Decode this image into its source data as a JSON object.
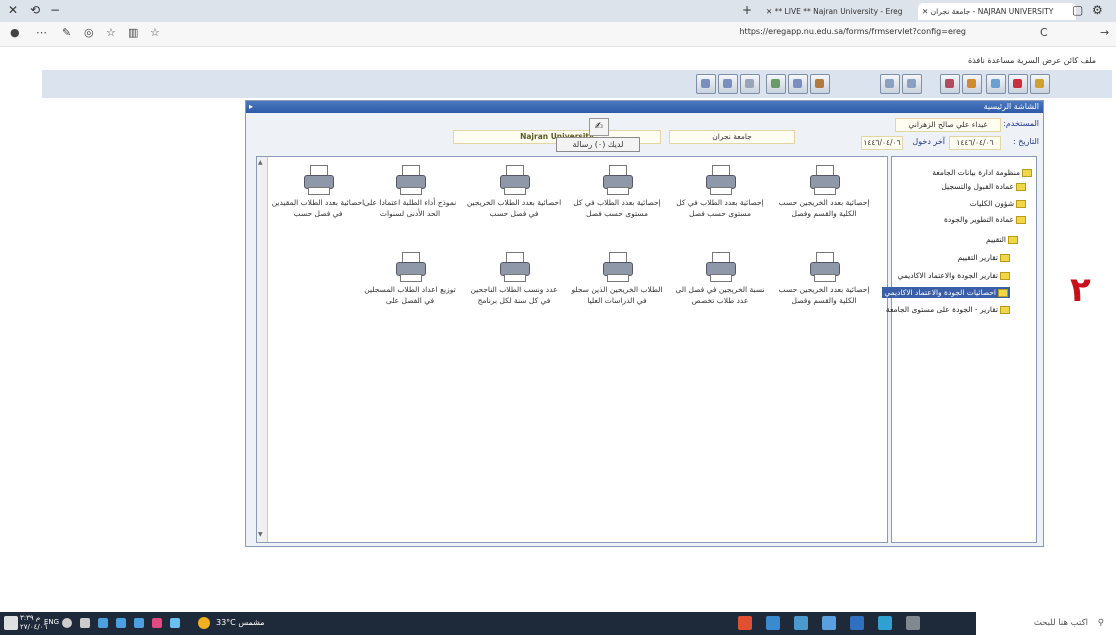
{
  "browser": {
    "tabs": [
      {
        "label": "جامعة نجران - NAJRAN UNIVERSITY"
      },
      {
        "label": "** LIVE ** Najran University - Ereg"
      }
    ],
    "url": "https://eregapp.nu.edu.sa/forms/frmservlet?config=ereg"
  },
  "forms_menu": "ملف كائن عرض السرية مساعدة نافذة",
  "window": {
    "title": "الشاشة الرئيسية"
  },
  "header": {
    "user_label": "المستخدم:",
    "user_name": "غيداء علي صالح الزهراني",
    "date_label": "التاريخ :",
    "date_value": "١٤٤٦/٠٤/٠٦",
    "last_login_label": "آخر دخول",
    "last_login_value": "١٤٤٦/٠٤/٠٦",
    "uni_ar": "جامعة نجران",
    "uni_en": "Najran University",
    "messages": "لديك (٠) رسالة"
  },
  "reports": [
    {
      "label": "إحصائية بعدد الخريجين حسب الكلية والقسم وفصل"
    },
    {
      "label": "إحصائية بعدد الطلاب في كل مستوى حسب فصل"
    },
    {
      "label": "إحصائية بعدد الطلاب في كل مستوى حسب فصل"
    },
    {
      "label": "احصائية بعدد الطلاب الخريجين في فصل حسب"
    },
    {
      "label": "نموذج أداء الطلبة اعتمادا على الحد الأدنى لسنوات"
    },
    {
      "label": "احصائية بعدد الطلاب المقيدين في فصل حسب"
    },
    {
      "label": "إحصائية بعدد الخريجين حسب الكلية والقسم وفصل"
    },
    {
      "label": "نسبة الخريجين في فصل الى عدد طلاب تخصص"
    },
    {
      "label": "الطلاب الخريجين الذين سجلو في الدراسات العليا"
    },
    {
      "label": "عدد ونسب الطلاب الناجحين في كل سنة لكل برنامج"
    },
    {
      "label": "توزيع اعداد الطلاب المسجلين في الفصل على"
    }
  ],
  "tree": [
    {
      "label": "منظومة ادارة بيانات الجامعة"
    },
    {
      "label": "عمادة القبول والتسجيل"
    },
    {
      "label": "شؤون الكليات"
    },
    {
      "label": "عمادة التطوير والجودة"
    },
    {
      "label": "التقييم"
    },
    {
      "label": "تقارير التقييم"
    },
    {
      "label": "تقارير الجودة والاعتماد الاكاديمي"
    },
    {
      "label": "احصائيات الجودة والاعتماد الاكاديمي"
    },
    {
      "label": "تقارير - الجودة على مستوى الجامعة"
    }
  ],
  "annotation": "٢",
  "taskbar": {
    "search": "اكتب هنا للبحث",
    "weather": "33°C مشمس",
    "lang": "ENG",
    "time": "م ٣:٣٩",
    "date": "٢٧/٠٤/٠٦"
  },
  "colors": {
    "accent": "#2d5aa8",
    "selected": "#3a5ea8",
    "annotation": "#c8101a"
  }
}
